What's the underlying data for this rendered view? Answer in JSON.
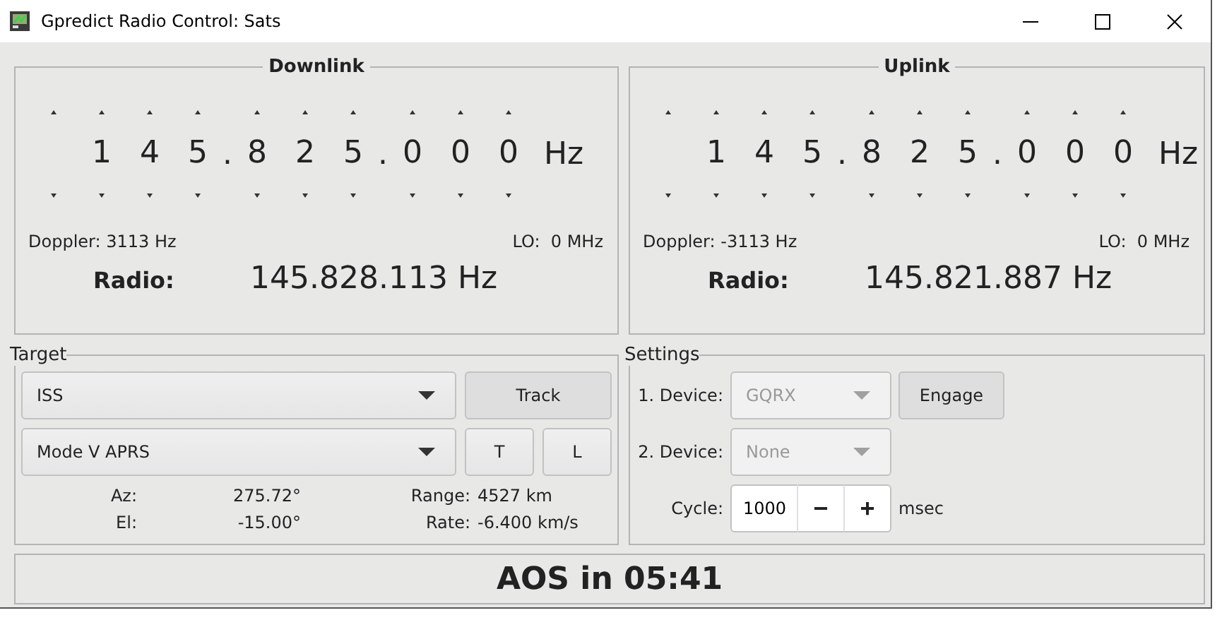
{
  "window": {
    "title": "Gpredict Radio Control: Sats"
  },
  "downlink": {
    "title": "Downlink",
    "digits": [
      {
        "kind": "digit",
        "text": "1"
      },
      {
        "kind": "digit",
        "text": "4"
      },
      {
        "kind": "digit",
        "text": "5"
      },
      {
        "kind": "separator",
        "text": "."
      },
      {
        "kind": "digit",
        "text": "8"
      },
      {
        "kind": "digit",
        "text": "2"
      },
      {
        "kind": "digit",
        "text": "5"
      },
      {
        "kind": "separator",
        "text": "."
      },
      {
        "kind": "digit",
        "text": "0"
      },
      {
        "kind": "digit",
        "text": "0"
      },
      {
        "kind": "digit",
        "text": "0"
      }
    ],
    "unit": "Hz",
    "doppler": "Doppler: 3113 Hz",
    "lo": "LO:  0 MHz",
    "radio_label": "Radio:",
    "radio_frequency": "145.828.113 Hz"
  },
  "uplink": {
    "title": "Uplink",
    "digits": [
      {
        "kind": "digit",
        "text": "1"
      },
      {
        "kind": "digit",
        "text": "4"
      },
      {
        "kind": "digit",
        "text": "5"
      },
      {
        "kind": "separator",
        "text": "."
      },
      {
        "kind": "digit",
        "text": "8"
      },
      {
        "kind": "digit",
        "text": "2"
      },
      {
        "kind": "digit",
        "text": "5"
      },
      {
        "kind": "separator",
        "text": "."
      },
      {
        "kind": "digit",
        "text": "0"
      },
      {
        "kind": "digit",
        "text": "0"
      },
      {
        "kind": "digit",
        "text": "0"
      }
    ],
    "unit": "Hz",
    "doppler": "Doppler: -3113 Hz",
    "lo": "LO:  0 MHz",
    "radio_label": "Radio:",
    "radio_frequency": "145.821.887 Hz"
  },
  "target": {
    "title": "Target",
    "satellite": "ISS",
    "track_button": "Track",
    "transponder": "Mode V APRS",
    "buttons": [
      "T",
      "L"
    ],
    "readouts": [
      {
        "label": "Az:",
        "value": "275.72°",
        "label_2": "Range:",
        "value_2": "4527 km"
      },
      {
        "label": "El:",
        "value": "-15.00°",
        "label_2": "Rate:",
        "value_2": "-6.400 km/s"
      }
    ]
  },
  "settings": {
    "title": "Settings",
    "devices": [
      {
        "label": "1. Device:",
        "value": "GQRX",
        "disabled": true
      },
      {
        "label": "2. Device:",
        "value": "None",
        "disabled": true
      }
    ],
    "engage_button": "Engage",
    "cycle": {
      "label": "Cycle:",
      "value": "1000",
      "minus": "−",
      "plus": "+",
      "unit": "msec"
    }
  },
  "status": "AOS in 05:41"
}
